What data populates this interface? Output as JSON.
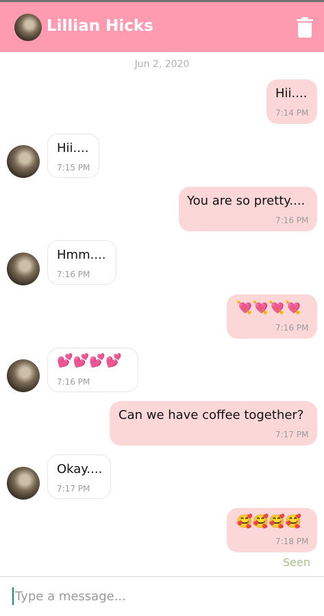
{
  "header": {
    "contact_name": "Lillian Hicks",
    "avatar_icon": "contact-avatar-icon",
    "delete_icon": "trash-icon",
    "background_color": "#ff9bb0"
  },
  "date_divider": "Jun 2, 2020",
  "messages": [
    {
      "direction": "out",
      "text": "Hii....",
      "time": "7:14 PM"
    },
    {
      "direction": "in",
      "text": "Hii....",
      "time": "7:15 PM"
    },
    {
      "direction": "out",
      "text": "You are so pretty....",
      "time": "7:16 PM"
    },
    {
      "direction": "in",
      "text": "Hmm....",
      "time": "7:16 PM"
    },
    {
      "direction": "out",
      "text": "💘💘💘💘",
      "time": "7:16 PM"
    },
    {
      "direction": "in",
      "text": "💕💕💕💕",
      "time": "7:16 PM"
    },
    {
      "direction": "out",
      "text": "Can we have coffee together?",
      "time": "7:17 PM"
    },
    {
      "direction": "in",
      "text": "Okay....",
      "time": "7:17 PM"
    },
    {
      "direction": "out",
      "text": "🥰🥰🥰🥰",
      "time": "7:18 PM"
    }
  ],
  "status": {
    "seen": "Seen"
  },
  "composer": {
    "placeholder": "Type a message..."
  },
  "colors": {
    "outgoing_bubble": "#fcd7d8",
    "incoming_bubble": "#ffffff",
    "seen_text": "#a8c08a"
  }
}
